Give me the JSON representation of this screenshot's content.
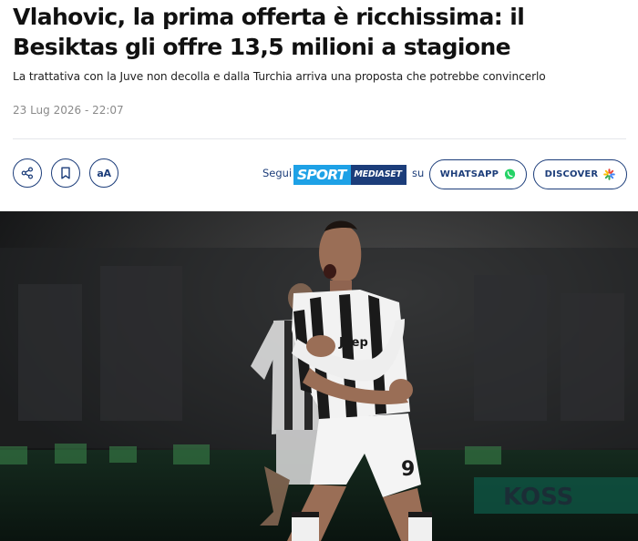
{
  "article": {
    "title": "Vlahovic, la prima offerta è ricchissima: il Besiktas gli offre 13,5 milioni a stagione",
    "subtitle": "La trattativa con la Juve non decolla e dalla Turchia arriva una proposta che potrebbe convincerlo",
    "date": "23 Lug 2026 - 22:07"
  },
  "toolbar": {
    "share_icon": "share-icon",
    "bookmark_icon": "bookmark-icon",
    "font_size_label": "aA"
  },
  "follow": {
    "prefix": "Segui",
    "brand_sport": "SPORT",
    "brand_mediaset": "MEDIASET",
    "suffix": "su",
    "whatsapp_label": "WHATSAPP",
    "discover_label": "DISCOVER",
    "whatsapp_color": "#25d366"
  },
  "photo": {
    "jersey_number": "9",
    "jersey_sponsor": "Jeep",
    "board_text": "KOSS"
  }
}
